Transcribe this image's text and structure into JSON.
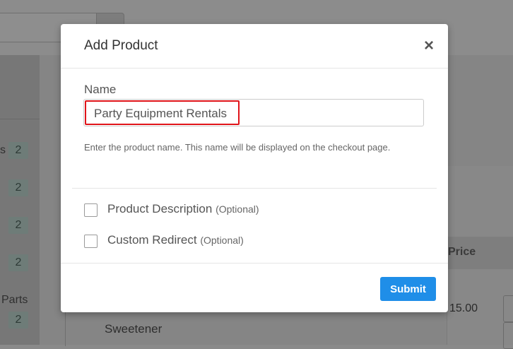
{
  "background": {
    "sidebar_badges": [
      "2",
      "2",
      "2",
      "2",
      "2"
    ],
    "sidebar_fragment_top": "s",
    "sidebar_fragment_parts": "Parts",
    "table_header_price": "Price",
    "row_product_name": "Sweetener",
    "row_price": "15.00"
  },
  "modal": {
    "title": "Add Product",
    "close_symbol": "×",
    "name_label": "Name",
    "name_value": "Party Equipment Rentals",
    "help_text": "Enter the product name. This name will be displayed on the checkout page.",
    "options": [
      {
        "label": "Product Description",
        "sub": "(Optional)"
      },
      {
        "label": "Custom Redirect",
        "sub": "(Optional)"
      }
    ],
    "submit_label": "Submit"
  },
  "colors": {
    "accent": "#1f8ee8",
    "highlight": "#e0141a"
  }
}
